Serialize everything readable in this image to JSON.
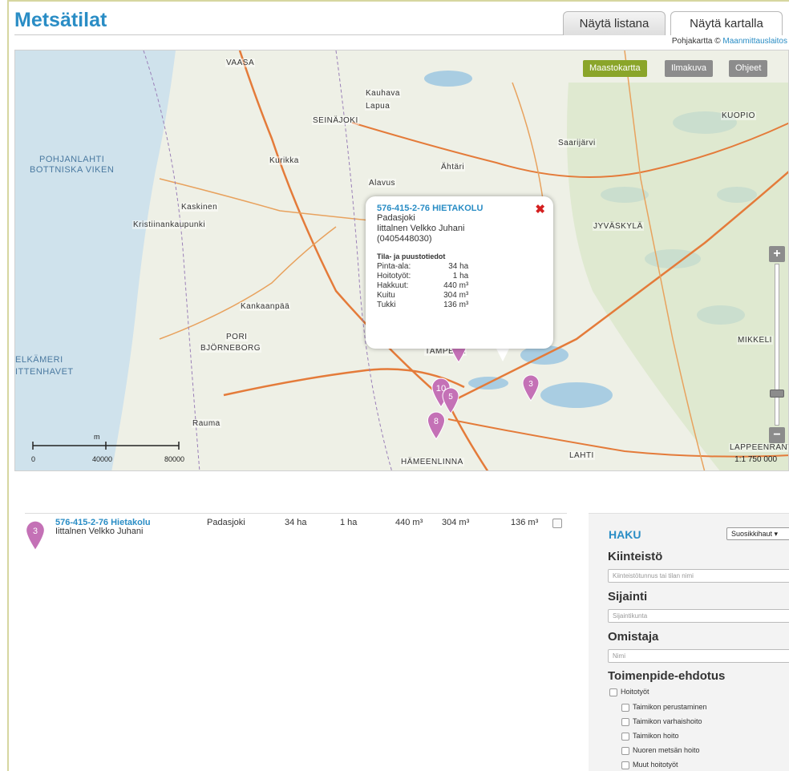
{
  "header": {
    "title": "Metsätilat",
    "tabs": [
      {
        "label": "Näytä listana",
        "active": false
      },
      {
        "label": "Näytä kartalla",
        "active": true
      }
    ],
    "attribution_prefix": "Pohjakartta ©",
    "attribution_link": "Maanmittauslaitos"
  },
  "map": {
    "buttons": [
      {
        "label": "Maastokartta",
        "active": true
      },
      {
        "label": "Ilmakuva",
        "active": false
      },
      {
        "label": "Ohjeet",
        "active": false
      }
    ],
    "zoom_in": "+",
    "zoom_out": "−",
    "scale_label": "1:1 750 000",
    "scale_ticks": [
      "0",
      "40000",
      "80000"
    ],
    "scale_unit": "m",
    "labels": {
      "sea1": "POHJANLAHTI",
      "sea2": "BOTTNISKA VIKEN",
      "sea3": "ELKÄMERI",
      "sea4": "ITTENHAVET",
      "vaasa": "VAASA",
      "seinajoki": "SEINÄJOKI",
      "kaskinen": "Kaskinen",
      "kristiinankaupunki": "Kristiinankaupunki",
      "pori": "PORI",
      "bjorneborg": "BJÖRNEBORG",
      "rauma": "Rauma",
      "jyvaskyla": "JYVÄSKYLÄ",
      "kuopio": "KUOPIO",
      "tampere": "TAMPERE",
      "hameenlinna": "HÄMEENLINNA",
      "lahti": "LAHTI",
      "lappeenranta": "LAPPEENRANTA",
      "saarijarvi": "Saarijärvi",
      "alavus": "Alavus",
      "ahtari": "Ähtäri",
      "kauhava": "Kauhava",
      "lapua": "Lapua",
      "kurikka": "Kurikka",
      "kankaanpaa": "Kankaanpää",
      "mikkeli": "MIKKELI"
    },
    "pins": [
      {
        "label": "3"
      },
      {
        "label": "10"
      },
      {
        "label": "5"
      },
      {
        "label": "8"
      },
      {
        "label": "3"
      }
    ],
    "popup": {
      "title": "576-415-2-76 HIETAKOLU",
      "municipality": "Padasjoki",
      "owner": "Iittalnen Velkko Juhani",
      "phone": "(0405448030)",
      "section_title": "Tila- ja puustotiedot",
      "close": "✖",
      "rows": [
        {
          "label": "Pinta-ala:",
          "value": "34 ha"
        },
        {
          "label": "Hoitotyöt:",
          "value": "1 ha"
        },
        {
          "label": "Hakkuut:",
          "value": "440 m³"
        },
        {
          "label": "Kuitu",
          "value": "304 m³"
        },
        {
          "label": "Tukki",
          "value": "136 m³"
        }
      ]
    }
  },
  "list": {
    "rows": [
      {
        "pin": "3",
        "name": "576-415-2-76 Hietakolu",
        "owner": "Iittalnen Velkko Juhani",
        "municipality": "Padasjoki",
        "area": "34 ha",
        "care": "1 ha",
        "cuttings": "440 m³",
        "fiber": "304 m³",
        "log": "136 m³"
      }
    ]
  },
  "search": {
    "title": "HAKU",
    "saved_select": "Suosikkihaut ▾",
    "property_label": "Kiinteistö",
    "property_placeholder": "Kiinteistötunnus tai tilan nimi",
    "location_label": "Sijainti",
    "location_placeholder": "Sijaintikunta",
    "owner_label": "Omistaja",
    "owner_placeholder": "Nimi",
    "measure_label": "Toimenpide-ehdotus",
    "checkboxes": [
      {
        "label": "Hoitotyöt",
        "level": 0
      },
      {
        "label": "Taimikon perustaminen",
        "level": 1
      },
      {
        "label": "Taimikon varhaishoito",
        "level": 1
      },
      {
        "label": "Taimikon hoito",
        "level": 1
      },
      {
        "label": "Nuoren metsän hoito",
        "level": 1
      },
      {
        "label": "Muut hoitotyöt",
        "level": 1
      }
    ]
  },
  "colors": {
    "brand": "#2a8dc5",
    "pin": "#c471b6",
    "map_button_active": "#8aa52a",
    "close": "#d42020"
  }
}
